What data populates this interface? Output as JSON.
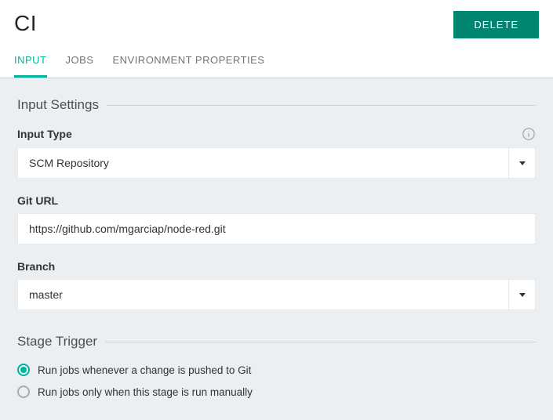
{
  "header": {
    "title": "CI",
    "delete_label": "DELETE"
  },
  "tabs": [
    {
      "label": "INPUT",
      "active": true
    },
    {
      "label": "JOBS",
      "active": false
    },
    {
      "label": "ENVIRONMENT PROPERTIES",
      "active": false
    }
  ],
  "sections": {
    "input_settings": {
      "title": "Input Settings",
      "fields": {
        "input_type": {
          "label": "Input Type",
          "value": "SCM Repository"
        },
        "git_url": {
          "label": "Git URL",
          "value": "https://github.com/mgarciap/node-red.git"
        },
        "branch": {
          "label": "Branch",
          "value": "master"
        }
      }
    },
    "stage_trigger": {
      "title": "Stage Trigger",
      "options": [
        {
          "label": "Run jobs whenever a change is pushed to Git",
          "selected": true
        },
        {
          "label": "Run jobs only when this stage is run manually",
          "selected": false
        }
      ]
    }
  }
}
